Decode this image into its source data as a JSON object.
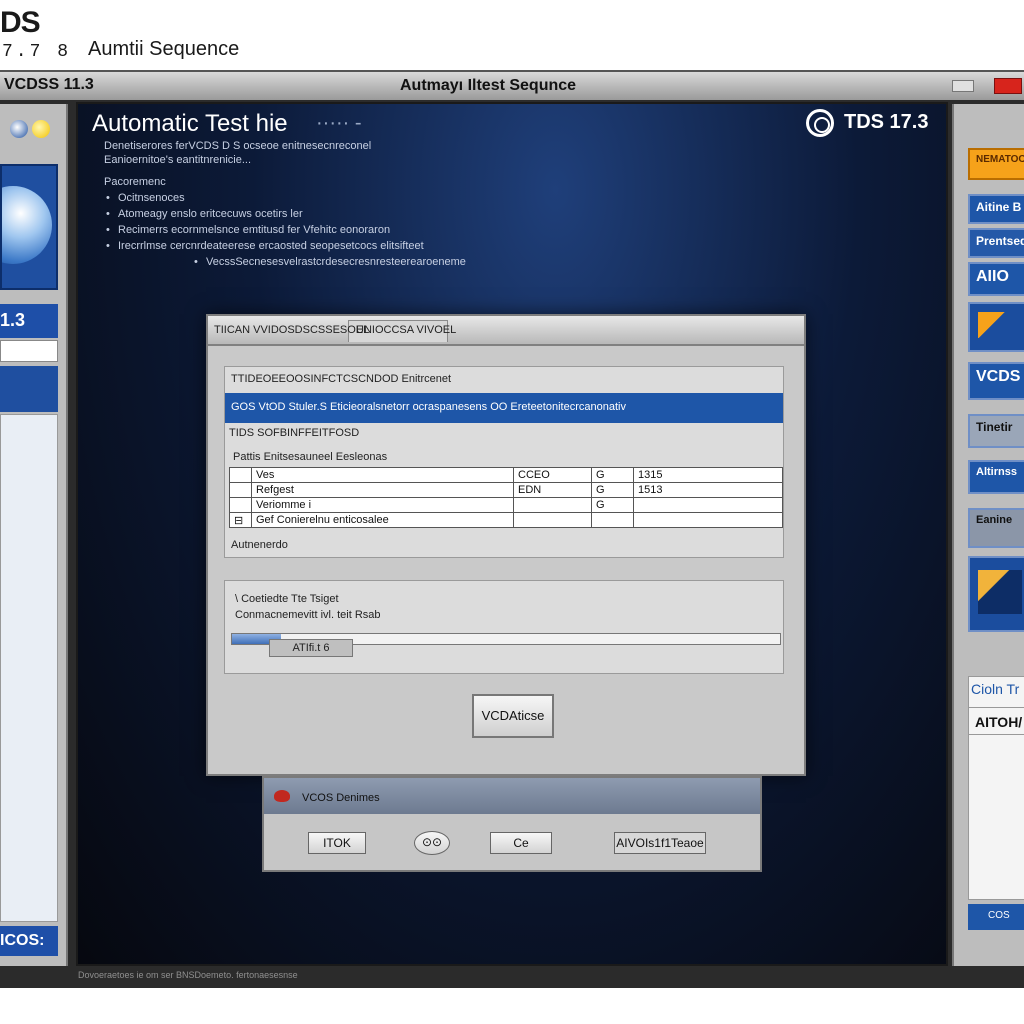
{
  "header": {
    "logo": "DS",
    "logo_version": "7.7 8",
    "title": "Aumtii Sequence"
  },
  "window": {
    "title_left": "VCDSS 11.3",
    "title_center": "Autmayı Iltest Sequnce"
  },
  "left_pane": {
    "version_label": "1.3",
    "bottom_label": "ICOS:"
  },
  "center": {
    "heading": "Automatic Test hie",
    "heading_tail": "·····  -",
    "badge": "TDS 17.3",
    "desc_lines": [
      "Denetiserores ferVCDS D S ocseoe enitnesecnreconel",
      "Eanioernitoe's eantitnrenicie..."
    ],
    "section_label": "Pacoremenc",
    "bullets": [
      "Ocitnsenoces",
      "Atomeagy enslo eritcecuws ocetirs ler",
      "Recimerrs ecornmelsnce emtitusd fer Vfehitc eonoraron",
      "Irecrrlmse cercnrdeateerese ercaosted seopesetcocs elitsifteet",
      "VecssSecnesesvelrastcrdesecresnresteerearoeneme"
    ],
    "footer": "Dovoeraetoes ie om ser BNSDoemeto. fertonaesesnse"
  },
  "dialog": {
    "tab1": "TIICAN VVIDOSDSCSSESOEL",
    "tab2": "UNIOCCSA VIVOEL",
    "group1_heading": "TTIDEOEEOOSINFCTCSCNDOD Enitrcenet",
    "highlight": "GOS VtOD Stuler.S Eticieoralsnetorr ocraspanesens OO Ereteetonitecrcanonativ",
    "sub_heading": "TIDS SOFBINFFEITFOSD",
    "sub_label": "Pattis Enitsesauneel Eesleonas",
    "table": [
      {
        "a": "Ves",
        "b": "CCEO",
        "c": "G",
        "d": "1315"
      },
      {
        "a": "Refgest",
        "b": "EDN",
        "c": "G",
        "d": "1513"
      },
      {
        "a": "Veriomme i",
        "b": "",
        "c": "G",
        "d": ""
      },
      {
        "a": "Gef Conierelnu enticosalee",
        "b": "",
        "c": "",
        "d": ""
      }
    ],
    "table_row_marker": "⊟",
    "group1_footer": "Autnenerdo",
    "group2_line1": "\\ Coetiedte Tte Tsiget",
    "group2_line2": "Conmacnemevitt ivl. teit Rsab",
    "progress": 0.09,
    "group2_button": "ATIfi.t  6",
    "main_button": "VCDAticse"
  },
  "dialog2": {
    "title": "VCOS Denimes",
    "ok_label": "ITOK",
    "round_label": "⊙⊙",
    "c_label": "Ce",
    "auto_label": "AIVOIs1f1Teaoe"
  },
  "right_pane": {
    "b1": "NEMATOOEN",
    "b2": "Aitine B I",
    "b3": "Prentsed",
    "b4": "AIIO",
    "b6": "VCDS",
    "b7": "Tinetir",
    "b8": "Altirnss",
    "b9": "Eanine",
    "b11": "Cioln Tr",
    "b12": "AITOH/",
    "b13": "COS"
  },
  "colors": {
    "accent_blue": "#1e56a8",
    "orange": "#f6a21a",
    "close_red": "#d7241c"
  }
}
